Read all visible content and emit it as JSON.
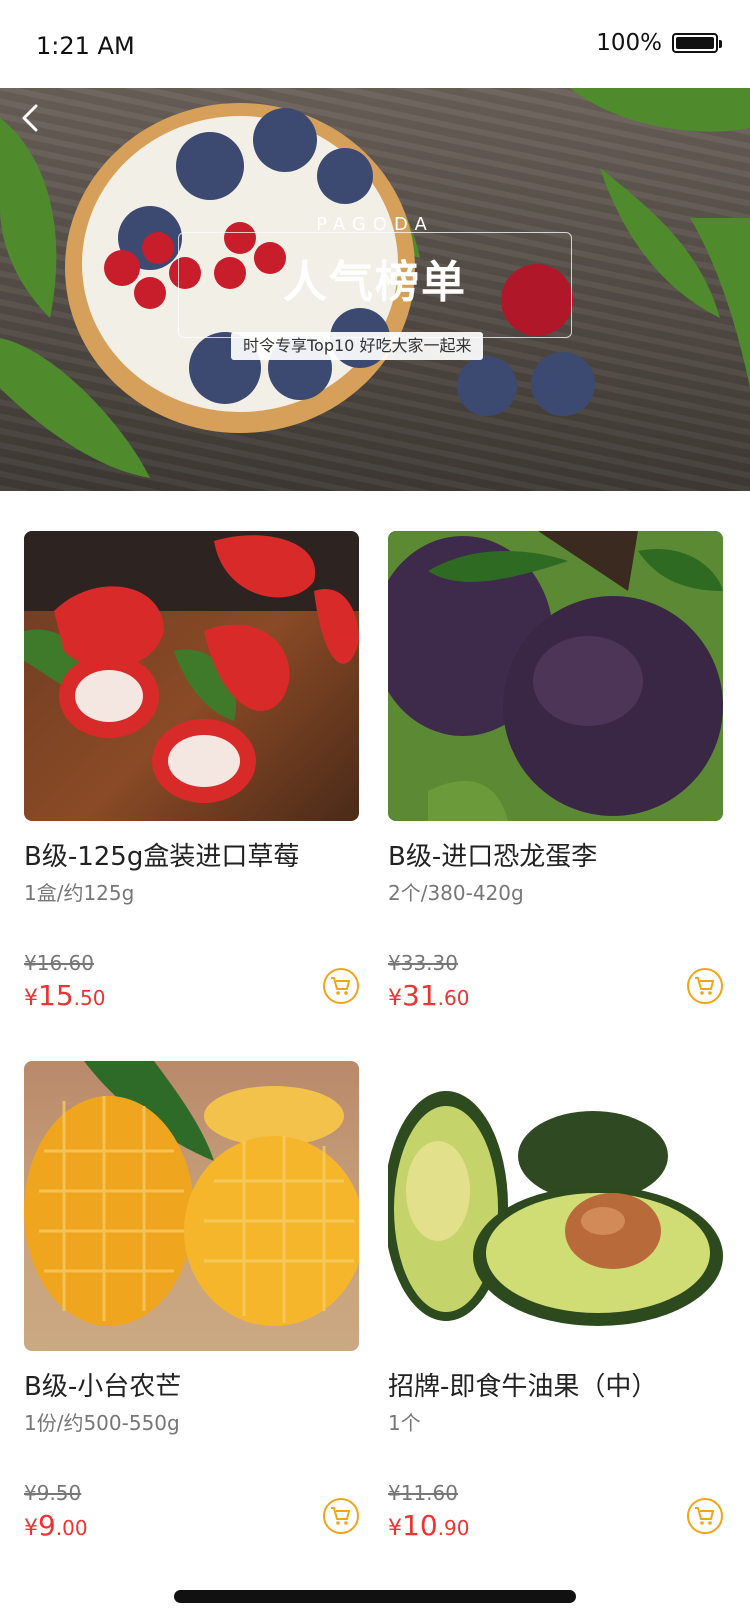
{
  "status_bar": {
    "time": "1:21 AM",
    "battery_percent": "100%"
  },
  "hero": {
    "brand": "PAGODA",
    "title": "人气榜单",
    "tagline": "时令专享Top10 好吃大家一起来"
  },
  "products": [
    {
      "name": "B级-125g盒装进口草莓",
      "spec": "1盒/约125g",
      "old_price": "¥16.60",
      "price_currency": "¥",
      "price_int": "15",
      "price_dec": ".50"
    },
    {
      "name": "B级-进口恐龙蛋李",
      "spec": "2个/380-420g",
      "old_price": "¥33.30",
      "price_currency": "¥",
      "price_int": "31",
      "price_dec": ".60"
    },
    {
      "name": "B级-小台农芒",
      "spec": "1份/约500-550g",
      "old_price": "¥9.50",
      "price_currency": "¥",
      "price_int": "9",
      "price_dec": ".00"
    },
    {
      "name": "招牌-即食牛油果（中）",
      "spec": "1个",
      "old_price": "¥11.60",
      "price_currency": "¥",
      "price_int": "10",
      "price_dec": ".90"
    }
  ],
  "colors": {
    "price_red": "#e33333",
    "cart_orange": "#f0a418"
  },
  "icons": {
    "back": "chevron-left-icon",
    "cart": "shopping-cart-icon"
  }
}
